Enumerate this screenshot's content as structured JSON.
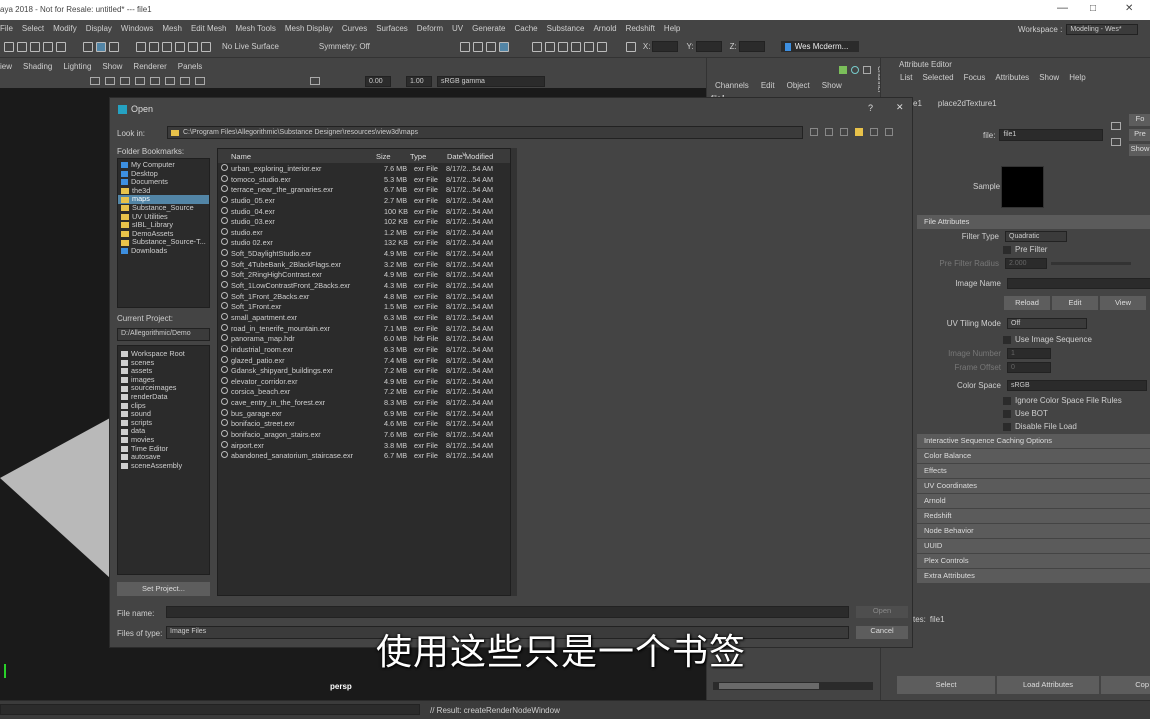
{
  "app": {
    "title": "aya 2018 - Not for Resale: untitled*   ---   file1",
    "workspace_label": "Workspace :",
    "workspace_value": "Modeling - Wes*",
    "user": "Wes Mcderm..."
  },
  "menubar": [
    "File",
    "Select",
    "Modify",
    "Display",
    "Windows",
    "Mesh",
    "Edit Mesh",
    "Mesh Tools",
    "Mesh Display",
    "Curves",
    "Surfaces",
    "Deform",
    "UV",
    "Generate",
    "Cache",
    "Substance",
    "Arnold",
    "Redshift",
    "Help"
  ],
  "shelf": {
    "live_surface": "No Live Surface",
    "symmetry": "Symmetry: Off",
    "x_label": "X:",
    "y_label": "Y:",
    "z_label": "Z:"
  },
  "viewport": {
    "menu": [
      "iew",
      "Shading",
      "Lighting",
      "Show",
      "Renderer",
      "Panels"
    ],
    "value1": "0.00",
    "value2": "1.00",
    "colorspace": "sRGB gamma",
    "camera": "persp"
  },
  "channel_box": {
    "menu": [
      "Channels",
      "Edit",
      "Object",
      "Show"
    ],
    "node": "file1",
    "side_tab": "Channel"
  },
  "attribute_editor": {
    "title": "Attribute Editor",
    "menu": [
      "List",
      "Selected",
      "Focus",
      "Attributes",
      "Show",
      "Help"
    ],
    "tabs": [
      "e1",
      "place2dTexture1"
    ],
    "file_label": "file:",
    "file_value": "file1",
    "side_buttons": [
      "Fo",
      "Pre",
      "Show"
    ],
    "sample_label": "Sample",
    "file_attributes": "File Attributes",
    "filter_type_label": "Filter Type",
    "filter_type_value": "Quadratic",
    "pre_filter": "Pre Filter",
    "pre_filter_radius_label": "Pre Filter Radius",
    "pre_filter_radius_value": "2.000",
    "image_name_label": "Image Name",
    "reload": "Reload",
    "edit": "Edit",
    "view": "View",
    "uv_tiling_label": "UV Tiling Mode",
    "uv_tiling_value": "Off",
    "use_image_sequence": "Use Image Sequence",
    "image_number_label": "Image Number",
    "image_number_value": "1",
    "frame_offset_label": "Frame Offset",
    "frame_offset_value": "0",
    "color_space_label": "Color Space",
    "color_space_value": "sRGB",
    "ignore_rules": "Ignore Color Space File Rules",
    "use_bot": "Use BOT",
    "disable_load": "Disable File Load",
    "sections": [
      "Interactive Sequence Caching Options",
      "Color Balance",
      "Effects",
      "UV Coordinates",
      "Arnold",
      "Redshift",
      "Node Behavior",
      "UUID",
      "Plex Controls",
      "Extra Attributes"
    ],
    "notes_label": "tes:",
    "notes_value": "file1",
    "select": "Select",
    "load_attributes": "Load Attributes",
    "copy": "Cop"
  },
  "dialog": {
    "title": "Open",
    "help": "?",
    "close": "✕",
    "look_in_label": "Look in:",
    "look_in_path": "C:\\Program Files\\Allegorithmic\\Substance Designer\\resources\\view3d\\maps",
    "folder_bookmarks_label": "Folder Bookmarks:",
    "bookmarks": [
      {
        "name": "My Computer",
        "icon": "computer-icon"
      },
      {
        "name": "Desktop",
        "icon": "desktop-icon"
      },
      {
        "name": "Documents",
        "icon": "documents-icon"
      },
      {
        "name": "the3d",
        "icon": "folder-icon"
      },
      {
        "name": "maps",
        "icon": "folder-icon",
        "selected": true
      },
      {
        "name": "Substance_Source",
        "icon": "folder-icon"
      },
      {
        "name": "UV Utilities",
        "icon": "folder-icon"
      },
      {
        "name": "sIBL_Library",
        "icon": "folder-icon"
      },
      {
        "name": "DemoAssets",
        "icon": "folder-icon"
      },
      {
        "name": "Substance_Source-T...",
        "icon": "folder-icon"
      },
      {
        "name": "Downloads",
        "icon": "downloads-icon"
      }
    ],
    "current_project_label": "Current Project:",
    "current_project_value": "D:/Allegorithmic/Demo",
    "project_folders": [
      "Workspace Root",
      "scenes",
      "assets",
      "images",
      "sourceimages",
      "renderData",
      "clips",
      "sound",
      "scripts",
      "data",
      "movies",
      "Time Editor",
      "autosave",
      "sceneAssembly"
    ],
    "set_project": "Set Project...",
    "columns": [
      "Name",
      "Size",
      "Type",
      "Date Modified"
    ],
    "files": [
      {
        "name": "urban_exploring_interior.exr",
        "size": "7.6 MB",
        "type": "exr File",
        "date": "8/17/2...54 AM"
      },
      {
        "name": "tomoco_studio.exr",
        "size": "5.3 MB",
        "type": "exr File",
        "date": "8/17/2...54 AM"
      },
      {
        "name": "terrace_near_the_granaries.exr",
        "size": "6.7 MB",
        "type": "exr File",
        "date": "8/17/2...54 AM"
      },
      {
        "name": "studio_05.exr",
        "size": "2.7 MB",
        "type": "exr File",
        "date": "8/17/2...54 AM"
      },
      {
        "name": "studio_04.exr",
        "size": "100 KB",
        "type": "exr File",
        "date": "8/17/2...54 AM"
      },
      {
        "name": "studio_03.exr",
        "size": "102 KB",
        "type": "exr File",
        "date": "8/17/2...54 AM"
      },
      {
        "name": "studio.exr",
        "size": "1.2 MB",
        "type": "exr File",
        "date": "8/17/2...54 AM"
      },
      {
        "name": "studio 02.exr",
        "size": "132 KB",
        "type": "exr File",
        "date": "8/17/2...54 AM"
      },
      {
        "name": "Soft_5DaylightStudio.exr",
        "size": "4.9 MB",
        "type": "exr File",
        "date": "8/17/2...54 AM"
      },
      {
        "name": "Soft_4TubeBank_2BlackFlags.exr",
        "size": "3.2 MB",
        "type": "exr File",
        "date": "8/17/2...54 AM"
      },
      {
        "name": "Soft_2RingHighContrast.exr",
        "size": "4.9 MB",
        "type": "exr File",
        "date": "8/17/2...54 AM"
      },
      {
        "name": "Soft_1LowContrastFront_2Backs.exr",
        "size": "4.3 MB",
        "type": "exr File",
        "date": "8/17/2...54 AM"
      },
      {
        "name": "Soft_1Front_2Backs.exr",
        "size": "4.8 MB",
        "type": "exr File",
        "date": "8/17/2...54 AM"
      },
      {
        "name": "Soft_1Front.exr",
        "size": "1.5 MB",
        "type": "exr File",
        "date": "8/17/2...54 AM"
      },
      {
        "name": "small_apartment.exr",
        "size": "6.3 MB",
        "type": "exr File",
        "date": "8/17/2...54 AM"
      },
      {
        "name": "road_in_tenerife_mountain.exr",
        "size": "7.1 MB",
        "type": "exr File",
        "date": "8/17/2...54 AM"
      },
      {
        "name": "panorama_map.hdr",
        "size": "6.0 MB",
        "type": "hdr File",
        "date": "8/17/2...54 AM"
      },
      {
        "name": "industrial_room.exr",
        "size": "6.3 MB",
        "type": "exr File",
        "date": "8/17/2...54 AM"
      },
      {
        "name": "glazed_patio.exr",
        "size": "7.4 MB",
        "type": "exr File",
        "date": "8/17/2...54 AM"
      },
      {
        "name": "Gdansk_shipyard_buildings.exr",
        "size": "7.2 MB",
        "type": "exr File",
        "date": "8/17/2...54 AM"
      },
      {
        "name": "elevator_corridor.exr",
        "size": "4.9 MB",
        "type": "exr File",
        "date": "8/17/2...54 AM"
      },
      {
        "name": "corsica_beach.exr",
        "size": "7.2 MB",
        "type": "exr File",
        "date": "8/17/2...54 AM"
      },
      {
        "name": "cave_entry_in_the_forest.exr",
        "size": "8.3 MB",
        "type": "exr File",
        "date": "8/17/2...54 AM"
      },
      {
        "name": "bus_garage.exr",
        "size": "6.9 MB",
        "type": "exr File",
        "date": "8/17/2...54 AM"
      },
      {
        "name": "bonifacio_street.exr",
        "size": "4.6 MB",
        "type": "exr File",
        "date": "8/17/2...54 AM"
      },
      {
        "name": "bonifacio_aragon_stairs.exr",
        "size": "7.6 MB",
        "type": "exr File",
        "date": "8/17/2...54 AM"
      },
      {
        "name": "airport.exr",
        "size": "3.8 MB",
        "type": "exr File",
        "date": "8/17/2...54 AM"
      },
      {
        "name": "abandoned_sanatorium_staircase.exr",
        "size": "6.7 MB",
        "type": "exr File",
        "date": "8/17/2...54 AM"
      }
    ],
    "file_name_label": "File name:",
    "file_name_value": "",
    "files_of_type_label": "Files of type:",
    "files_of_type_value": "Image Files",
    "open": "Open",
    "cancel": "Cancel"
  },
  "status": {
    "result": "// Result: createRenderNodeWindow"
  },
  "subtitle": "使用这些只是一个书签"
}
